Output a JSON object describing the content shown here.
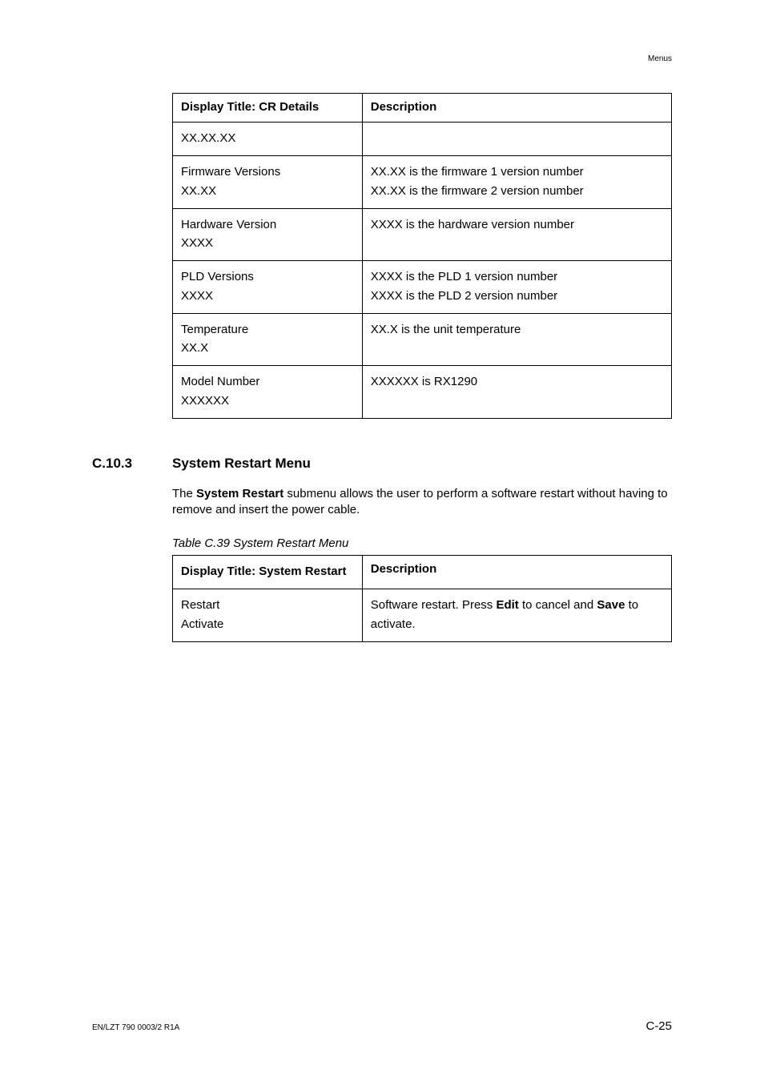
{
  "header": {
    "section_label": "Menus"
  },
  "table1": {
    "headers": [
      "Display Title: CR Details",
      "Description"
    ],
    "rows": [
      {
        "left": "XX.XX.XX",
        "right": ""
      },
      {
        "left": "Firmware Versions\nXX.XX",
        "right": "XX.XX is the firmware 1 version number\nXX.XX is the firmware 2 version number"
      },
      {
        "left": "Hardware Version\nXXXX",
        "right": "XXXX is the hardware version number"
      },
      {
        "left": "PLD Versions\nXXXX",
        "right": "XXXX is the PLD 1 version number\nXXXX is the PLD 2 version number"
      },
      {
        "left": "Temperature\nXX.X",
        "right": "XX.X is the unit temperature"
      },
      {
        "left": "Model Number\nXXXXXX",
        "right": "XXXXXX is RX1290"
      }
    ]
  },
  "section": {
    "number": "C.10.3",
    "title": "System Restart Menu",
    "para_pre": "The ",
    "para_bold1": "System Restart",
    "para_post": " submenu allows the user to perform a software restart without having to remove and insert the power cable."
  },
  "table2": {
    "caption_lead": "Table C.39",
    "caption_rest": " System Restart Menu",
    "headers": [
      "Display Title: System Restart",
      "Description"
    ],
    "row": {
      "left": "Restart\nActivate",
      "right_pre": "Software restart. Press ",
      "right_bold1": "Edit",
      "right_mid": " to cancel and ",
      "right_bold2": "Save",
      "right_post": " to activate."
    }
  },
  "footer": {
    "left": "EN/LZT 790 0003/2 R1A",
    "right": "C-25"
  }
}
